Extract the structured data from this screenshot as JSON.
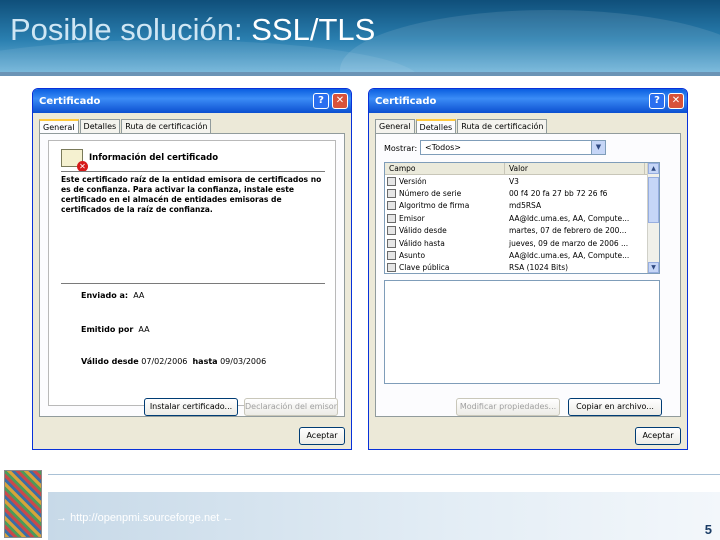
{
  "slide": {
    "title_part1": "Posible solución: ",
    "title_part2": "SSL/TLS",
    "footer_link": "http://openpmi.sourceforge.net",
    "arrow_right": "→",
    "arrow_left": "←",
    "page_number": "5"
  },
  "left_dialog": {
    "title": "Certificado",
    "help_glyph": "?",
    "close_glyph": "✕",
    "tabs": [
      "General",
      "Detalles",
      "Ruta de certificación"
    ],
    "active_tab": "General",
    "cert_heading": "Información del certificado",
    "warning_text": "Este certificado raíz de la entidad emisora de certificados no es de confianza. Para activar la confianza, instale este certificado en el almacén de entidades emisoras de certificados de la raíz de confianza.",
    "issued_to_label": "Enviado a:",
    "issued_to_value": "AA",
    "issued_by_label": "Emitido por",
    "issued_by_value": "AA",
    "valid_from_label": "Válido desde",
    "valid_from_value": "07/02/2006",
    "valid_to_label": "hasta",
    "valid_to_value": "09/03/2006",
    "install_button": "Instalar certificado...",
    "issuer_statement_button": "Declaración del emisor",
    "ok_button": "Aceptar"
  },
  "right_dialog": {
    "title": "Certificado",
    "help_glyph": "?",
    "close_glyph": "✕",
    "tabs": [
      "General",
      "Detalles",
      "Ruta de certificación"
    ],
    "active_tab": "Detalles",
    "show_label": "Mostrar:",
    "show_value": "<Todos>",
    "dropdown_glyph": "▼",
    "columns": [
      "Campo",
      "Valor"
    ],
    "rows": [
      {
        "field": "Versión",
        "value": "V3"
      },
      {
        "field": "Número de serie",
        "value": "00 f4 20 fa 27 bb 72 26 f6"
      },
      {
        "field": "Algoritmo de firma",
        "value": "md5RSA"
      },
      {
        "field": "Emisor",
        "value": "AA@ldc.uma.es, AA, Compute..."
      },
      {
        "field": "Válido desde",
        "value": "martes, 07 de febrero de 200..."
      },
      {
        "field": "Válido hasta",
        "value": "jueves, 09 de marzo de 2006 ..."
      },
      {
        "field": "Asunto",
        "value": "AA@ldc.uma.es, AA, Compute..."
      },
      {
        "field": "Clave pública",
        "value": "RSA (1024 Bits)"
      }
    ],
    "scroll_up_glyph": "▲",
    "scroll_down_glyph": "▼",
    "edit_properties_button": "Modificar propiedades...",
    "copy_to_file_button": "Copiar en archivo...",
    "ok_button": "Aceptar"
  }
}
